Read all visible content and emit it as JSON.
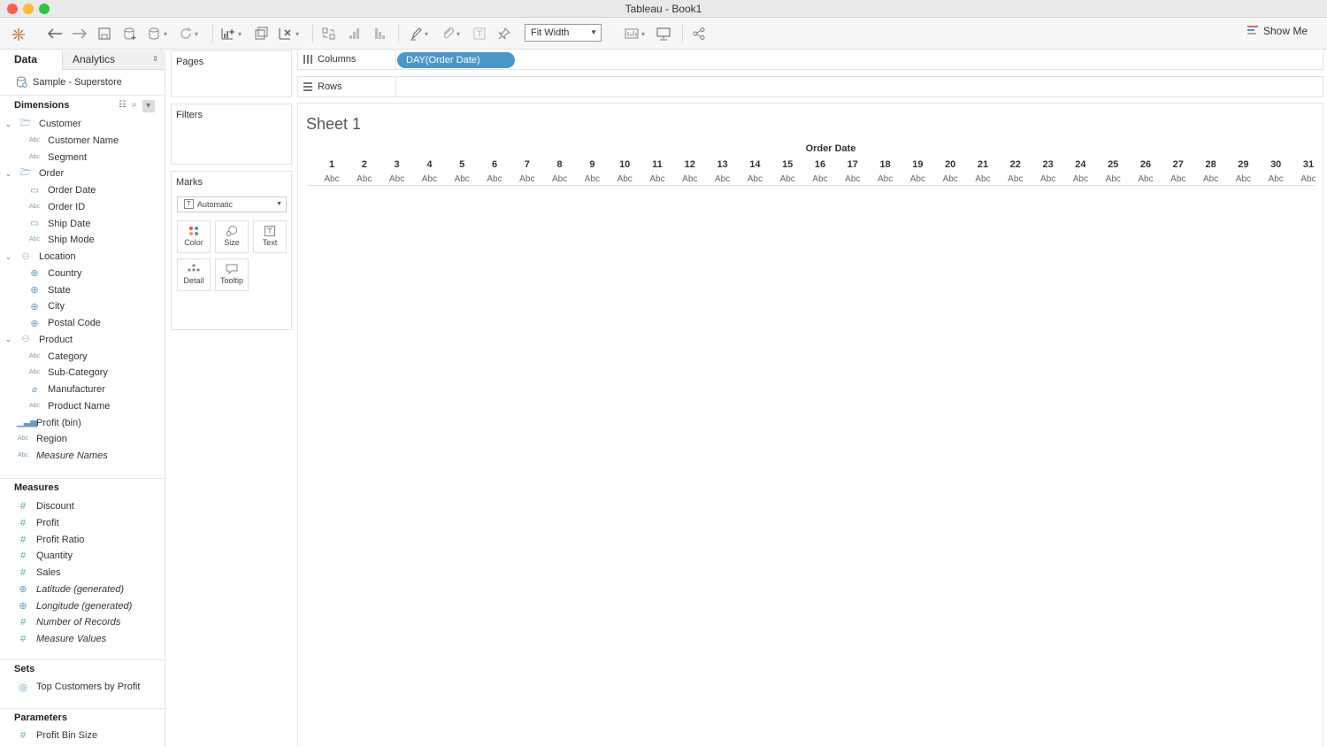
{
  "window": {
    "title": "Tableau - Book1"
  },
  "toolbar": {
    "fit_select": "Fit Width",
    "show_me": "Show Me"
  },
  "left_pane": {
    "tabs": {
      "data": "Data",
      "analytics": "Analytics"
    },
    "datasource": "Sample - Superstore",
    "dimensions_header": "Dimensions",
    "dimensions": [
      {
        "label": "Customer",
        "type": "folder",
        "indent": 0
      },
      {
        "label": "Customer Name",
        "type": "abc",
        "indent": 1
      },
      {
        "label": "Segment",
        "type": "abc",
        "indent": 1
      },
      {
        "label": "Order",
        "type": "folder",
        "indent": 0
      },
      {
        "label": "Order Date",
        "type": "date",
        "indent": 1
      },
      {
        "label": "Order ID",
        "type": "abc",
        "indent": 1
      },
      {
        "label": "Ship Date",
        "type": "date",
        "indent": 1
      },
      {
        "label": "Ship Mode",
        "type": "abc",
        "indent": 1
      },
      {
        "label": "Location",
        "type": "hierarchy",
        "indent": 0
      },
      {
        "label": "Country",
        "type": "globe",
        "indent": 1
      },
      {
        "label": "State",
        "type": "globe",
        "indent": 1
      },
      {
        "label": "City",
        "type": "globe",
        "indent": 1
      },
      {
        "label": "Postal Code",
        "type": "globe",
        "indent": 1
      },
      {
        "label": "Product",
        "type": "hierarchy",
        "indent": 0
      },
      {
        "label": "Category",
        "type": "abc",
        "indent": 1
      },
      {
        "label": "Sub-Category",
        "type": "abc",
        "indent": 1
      },
      {
        "label": "Manufacturer",
        "type": "clip",
        "indent": 1
      },
      {
        "label": "Product Name",
        "type": "abc",
        "indent": 1
      },
      {
        "label": "Profit (bin)",
        "type": "bin",
        "indent": 0
      },
      {
        "label": "Region",
        "type": "abc",
        "indent": 0
      },
      {
        "label": "Measure Names",
        "type": "abc",
        "indent": 0,
        "italic": true
      }
    ],
    "measures_header": "Measures",
    "measures": [
      {
        "label": "Discount",
        "type": "hash"
      },
      {
        "label": "Profit",
        "type": "hash"
      },
      {
        "label": "Profit Ratio",
        "type": "hash"
      },
      {
        "label": "Quantity",
        "type": "hash"
      },
      {
        "label": "Sales",
        "type": "hash"
      },
      {
        "label": "Latitude (generated)",
        "type": "globe",
        "italic": true
      },
      {
        "label": "Longitude (generated)",
        "type": "globe",
        "italic": true
      },
      {
        "label": "Number of Records",
        "type": "hash",
        "italic": true
      },
      {
        "label": "Measure Values",
        "type": "hash",
        "italic": true
      }
    ],
    "sets_header": "Sets",
    "sets": [
      {
        "label": "Top Customers by Profit"
      }
    ],
    "parameters_header": "Parameters",
    "parameters": [
      {
        "label": "Profit Bin Size"
      }
    ]
  },
  "cards": {
    "pages": "Pages",
    "filters": "Filters",
    "marks": "Marks",
    "mark_type": "Automatic",
    "mark_buttons": [
      "Color",
      "Size",
      "Text",
      "Detail",
      "Tooltip"
    ]
  },
  "shelves": {
    "columns_label": "Columns",
    "rows_label": "Rows",
    "columns_pill": "DAY(Order Date)"
  },
  "sheet": {
    "title": "Sheet 1",
    "header": "Order Date",
    "placeholder": "Abc",
    "days": [
      "1",
      "2",
      "3",
      "4",
      "5",
      "6",
      "7",
      "8",
      "9",
      "10",
      "11",
      "12",
      "13",
      "14",
      "15",
      "16",
      "17",
      "18",
      "19",
      "20",
      "21",
      "22",
      "23",
      "24",
      "25",
      "26",
      "27",
      "28",
      "29",
      "30",
      "31"
    ]
  },
  "colors": {
    "pill": "#4a97c9",
    "accent": "#5e9fc4"
  }
}
